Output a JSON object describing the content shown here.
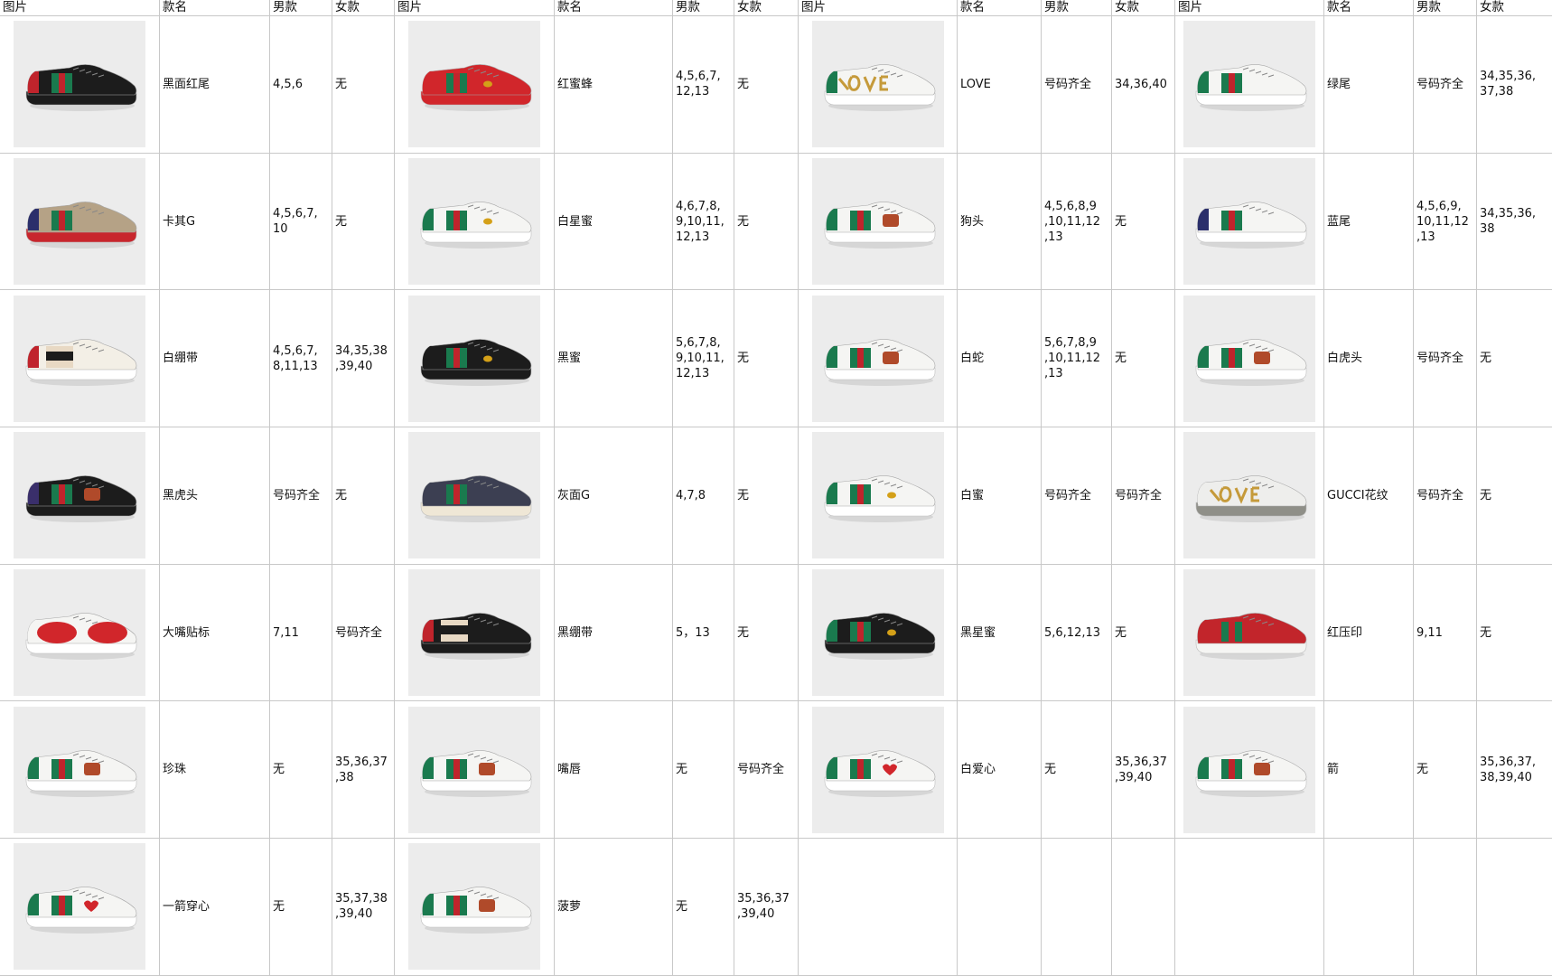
{
  "headers": [
    "图片",
    "款名",
    "男款",
    "女款",
    "图片",
    "款名",
    "男款",
    "女款",
    "图片",
    "款名",
    "男款",
    "女款",
    "图片",
    "款名",
    "男款",
    "女款"
  ],
  "rows": [
    [
      {
        "name": "黑面红尾",
        "men": "4,5,6",
        "women": "无",
        "shoe": {
          "body": "#1c1c1c",
          "sole": "#1c1c1c",
          "tab": "#c0242c",
          "mark": "none"
        }
      },
      {
        "name": "红蜜蜂",
        "men": "4,5,6,7,\n12,13",
        "women": "无",
        "shoe": {
          "body": "#d1262b",
          "sole": "#d1262b",
          "tab": "#d1262b",
          "mark": "bee"
        }
      },
      {
        "name": "LOVE",
        "men": "号码齐全",
        "women": "34,36,40",
        "shoe": {
          "body": "#f5f5f3",
          "sole": "#ffffff",
          "tab": "#1a7a4e",
          "mark": "love"
        }
      },
      {
        "name": "绿尾",
        "men": "号码齐全",
        "women": "34,35,36,\n37,38",
        "shoe": {
          "body": "#f5f5f3",
          "sole": "#ffffff",
          "tab": "#1a7a4e",
          "mark": "stripe"
        }
      }
    ],
    [
      {
        "name": "卡其G",
        "men": "4,5,6,7,\n10",
        "women": "无",
        "shoe": {
          "body": "#b5a286",
          "sole": "#c8262d",
          "tab": "#2b2f6b",
          "mark": "stripe"
        }
      },
      {
        "name": "白星蜜",
        "men": "4,6,7,8,\n9,10,11,\n12,13",
        "women": "无",
        "shoe": {
          "body": "#f5f5f3",
          "sole": "#ffffff",
          "tab": "#1a7a4e",
          "mark": "bee"
        }
      },
      {
        "name": "狗头",
        "men": "4,5,6,8,9\n,10,11,12\n,13",
        "women": "无",
        "shoe": {
          "body": "#f5f5f3",
          "sole": "#ffffff",
          "tab": "#1a7a4e",
          "mark": "patch"
        }
      },
      {
        "name": "蓝尾",
        "men": "4,5,6,9,\n10,11,12\n,13",
        "women": "34,35,36,\n38",
        "shoe": {
          "body": "#f5f5f3",
          "sole": "#ffffff",
          "tab": "#2b2f6b",
          "mark": "stripe"
        }
      }
    ],
    [
      {
        "name": "白绷带",
        "men": "4,5,6,7,\n8,11,13",
        "women": "34,35,38\n,39,40",
        "shoe": {
          "body": "#f3efe6",
          "sole": "#ffffff",
          "tab": "#c0242c",
          "mark": "band"
        }
      },
      {
        "name": "黑蜜",
        "men": "5,6,7,8,\n9,10,11,\n12,13",
        "women": "无",
        "shoe": {
          "body": "#1c1c1c",
          "sole": "#1c1c1c",
          "tab": "#1c1c1c",
          "mark": "bee"
        }
      },
      {
        "name": "白蛇",
        "men": "5,6,7,8,9\n,10,11,12\n,13",
        "women": "无",
        "shoe": {
          "body": "#f5f5f3",
          "sole": "#ffffff",
          "tab": "#1a7a4e",
          "mark": "patch"
        }
      },
      {
        "name": "白虎头",
        "men": "号码齐全",
        "women": "无",
        "shoe": {
          "body": "#f5f5f3",
          "sole": "#ffffff",
          "tab": "#1a7a4e",
          "mark": "patch"
        }
      }
    ],
    [
      {
        "name": "黑虎头",
        "men": "号码齐全",
        "women": "无",
        "shoe": {
          "body": "#1c1c1c",
          "sole": "#1c1c1c",
          "tab": "#3a2f6b",
          "mark": "patch"
        }
      },
      {
        "name": "灰面G",
        "men": "4,7,8",
        "women": "无",
        "shoe": {
          "body": "#3c3f52",
          "sole": "#efe7d6",
          "tab": "#3c3f52",
          "mark": "stripe"
        }
      },
      {
        "name": "白蜜",
        "men": "号码齐全",
        "women": "号码齐全",
        "shoe": {
          "body": "#f5f5f3",
          "sole": "#ffffff",
          "tab": "#1a7a4e",
          "mark": "bee"
        }
      },
      {
        "name": "GUCCI花纹",
        "men": "号码齐全",
        "women": "无",
        "shoe": {
          "body": "#eeeeec",
          "sole": "#8f8f88",
          "tab": "#eeeeec",
          "mark": "love"
        }
      }
    ],
    [
      {
        "name": "大嘴贴标",
        "men": "7,11",
        "women": "号码齐全",
        "shoe": {
          "body": "#f5f5f3",
          "sole": "#ffffff",
          "tab": "#f5f5f3",
          "mark": "lips"
        }
      },
      {
        "name": "黑绷带",
        "men": "5，13",
        "women": "无",
        "shoe": {
          "body": "#1c1c1c",
          "sole": "#1c1c1c",
          "tab": "#c0242c",
          "mark": "band"
        }
      },
      {
        "name": "黑星蜜",
        "men": "5,6,12,13",
        "women": "无",
        "shoe": {
          "body": "#1c1c1c",
          "sole": "#1c1c1c",
          "tab": "#1a7a4e",
          "mark": "bee"
        }
      },
      {
        "name": "红压印",
        "men": "9,11",
        "women": "无",
        "shoe": {
          "body": "#c2252b",
          "sole": "#f5f5f3",
          "tab": "#c2252b",
          "mark": "stripe"
        }
      }
    ],
    [
      {
        "name": "珍珠",
        "men": "无",
        "women": "35,36,37\n,38",
        "shoe": {
          "body": "#f5f5f3",
          "sole": "#ffffff",
          "tab": "#1a7a4e",
          "mark": "patch"
        }
      },
      {
        "name": "嘴唇",
        "men": "无",
        "women": "号码齐全",
        "shoe": {
          "body": "#f5f5f3",
          "sole": "#ffffff",
          "tab": "#1a7a4e",
          "mark": "patch"
        }
      },
      {
        "name": "白爱心",
        "men": "无",
        "women": "35,36,37\n,39,40",
        "shoe": {
          "body": "#f5f5f3",
          "sole": "#ffffff",
          "tab": "#1a7a4e",
          "mark": "heart"
        }
      },
      {
        "name": "箭",
        "men": "无",
        "women": "35,36,37,\n38,39,40",
        "shoe": {
          "body": "#f5f5f3",
          "sole": "#ffffff",
          "tab": "#1a7a4e",
          "mark": "patch"
        }
      }
    ],
    [
      {
        "name": "一箭穿心",
        "men": "无",
        "women": "35,37,38\n,39,40",
        "shoe": {
          "body": "#f5f5f3",
          "sole": "#ffffff",
          "tab": "#1a7a4e",
          "mark": "heart"
        }
      },
      {
        "name": "菠萝",
        "men": "无",
        "women": "35,36,37\n,39,40",
        "shoe": {
          "body": "#f5f5f3",
          "sole": "#ffffff",
          "tab": "#1a7a4e",
          "mark": "patch"
        }
      },
      null,
      null
    ]
  ]
}
